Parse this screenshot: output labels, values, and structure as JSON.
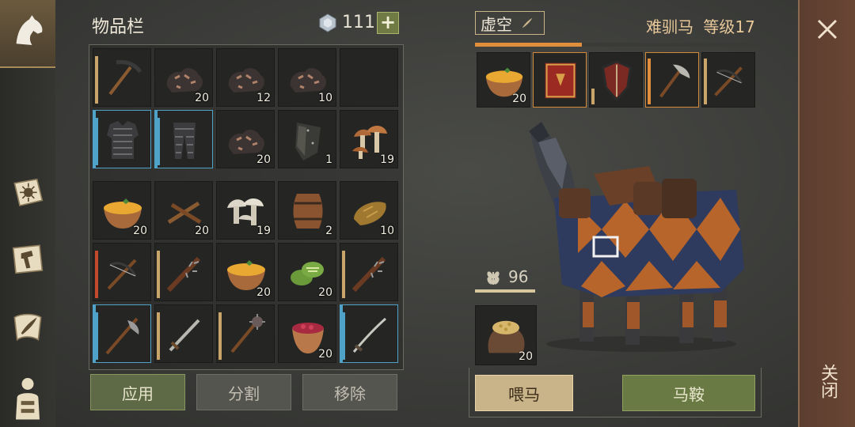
{
  "inventory": {
    "title": "物品栏",
    "currency": "111",
    "plus_label": "+",
    "slots": [
      {
        "icon": "pickaxe-icon",
        "count": "",
        "bar": "gold"
      },
      {
        "icon": "iron-ore-icon",
        "count": "20"
      },
      {
        "icon": "iron-ore-icon",
        "count": "12"
      },
      {
        "icon": "iron-ore-icon",
        "count": "10"
      },
      {
        "icon": "empty-slot",
        "count": ""
      },
      {
        "icon": "chainmail-armor-icon",
        "count": "",
        "bar": "blue"
      },
      {
        "icon": "chainmail-leggings-icon",
        "count": "",
        "bar": "blue"
      },
      {
        "icon": "iron-ore-icon",
        "count": "20"
      },
      {
        "icon": "shield-plate-icon",
        "count": "1"
      },
      {
        "icon": "mushrooms-icon",
        "count": "19"
      },
      {
        "icon": "soup-bowl-icon",
        "count": "20"
      },
      {
        "icon": "sticks-icon",
        "count": "20"
      },
      {
        "icon": "white-mushrooms-icon",
        "count": "19"
      },
      {
        "icon": "barrel-icon",
        "count": "2"
      },
      {
        "icon": "bread-icon",
        "count": "10"
      },
      {
        "icon": "crossbow-icon",
        "count": "",
        "bar": "red"
      },
      {
        "icon": "spiked-club-icon",
        "count": "",
        "bar": "gold"
      },
      {
        "icon": "soup-bowl-icon",
        "count": "20"
      },
      {
        "icon": "cucumber-slices-icon",
        "count": "20"
      },
      {
        "icon": "spiked-club-icon",
        "count": "",
        "bar": "gold"
      },
      {
        "icon": "halberd-icon",
        "count": "",
        "bar": "blue"
      },
      {
        "icon": "sword-icon",
        "count": "",
        "bar": "gold"
      },
      {
        "icon": "mace-icon",
        "count": "",
        "bar": "gold"
      },
      {
        "icon": "berry-bowl-icon",
        "count": "20"
      },
      {
        "icon": "saber-icon",
        "count": "",
        "bar": "blue"
      }
    ],
    "buttons": {
      "apply": "应用",
      "split": "分割",
      "remove": "移除"
    }
  },
  "horse": {
    "name": "虚空",
    "title_label": "难驯马",
    "level_label": "等级17",
    "health_fraction": 0.38,
    "equipment": [
      {
        "icon": "soup-bowl-icon",
        "count": "20"
      },
      {
        "icon": "red-book-icon",
        "count": ""
      },
      {
        "icon": "kite-shield-icon",
        "count": ""
      },
      {
        "icon": "pickaxe-axe-icon",
        "count": ""
      },
      {
        "icon": "crossbow-icon",
        "count": ""
      }
    ],
    "feed_value": "96",
    "food": {
      "icon": "grain-sack-icon",
      "count": "20"
    },
    "buttons": {
      "feed": "喂马",
      "saddle": "马鞍"
    }
  },
  "close": {
    "label": "关闭"
  },
  "colors": {
    "accent": "#e08d3c",
    "blue": "#4fa3c8",
    "green_button": "#5d6a45",
    "feed_button": "#c9b48a"
  }
}
